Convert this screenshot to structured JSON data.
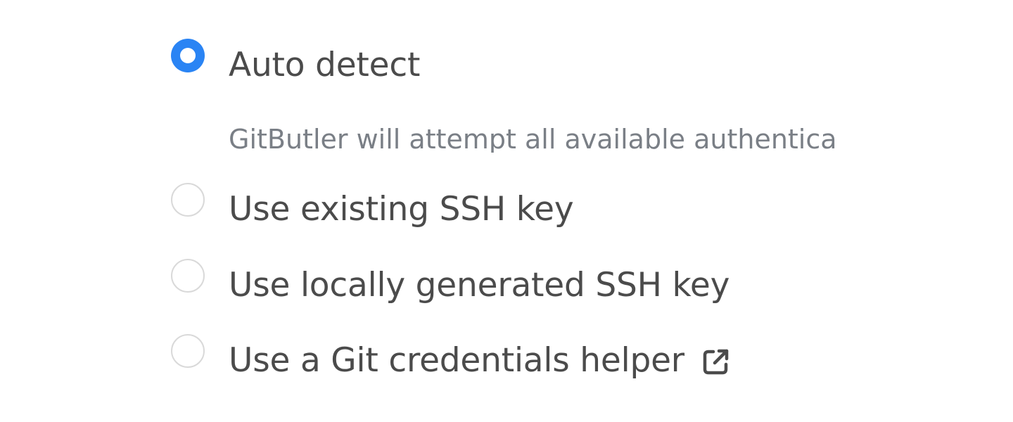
{
  "auth_options": {
    "items": [
      {
        "label": "Auto detect",
        "checked": true,
        "description": "GitButler will attempt all available authentica"
      },
      {
        "label": "Use existing SSH key",
        "checked": false
      },
      {
        "label": "Use locally generated SSH key",
        "checked": false
      },
      {
        "label": "Use a Git credentials helper",
        "checked": false,
        "icon": "external-link-icon"
      }
    ]
  },
  "colors": {
    "accent": "#2a84f4",
    "label_text": "#4b4b4b",
    "description_text": "#7a7f86",
    "radio_border": "#d9d9d9"
  }
}
